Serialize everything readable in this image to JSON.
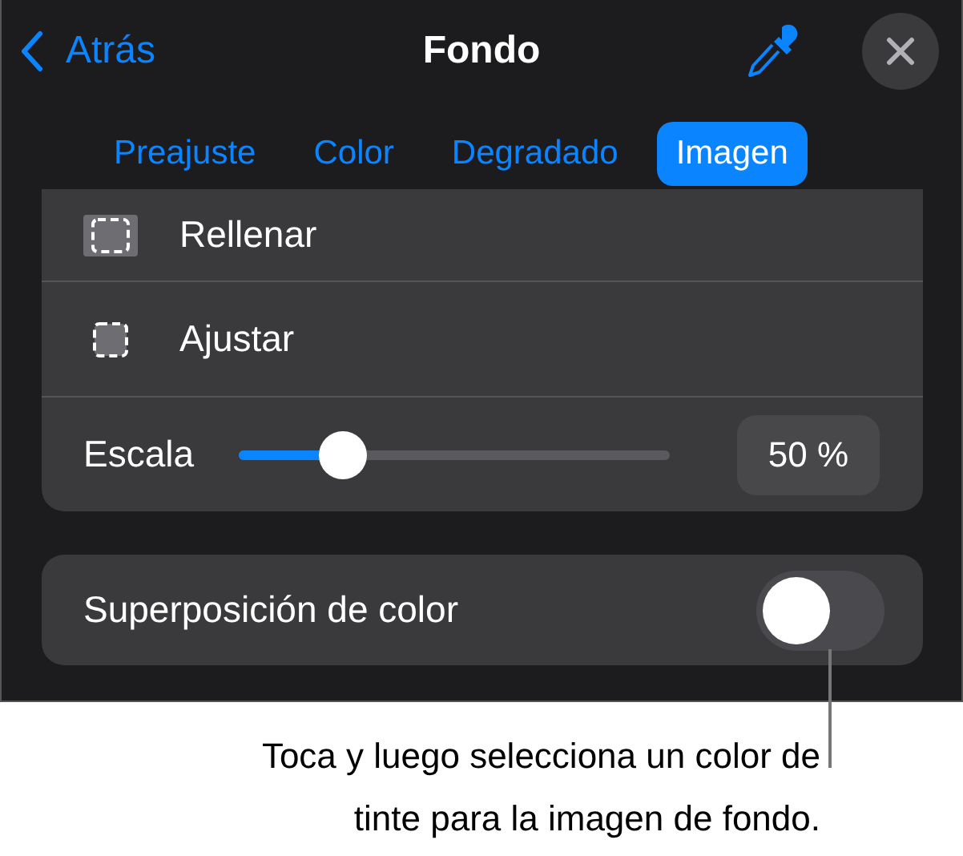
{
  "header": {
    "back": "Atrás",
    "title": "Fondo"
  },
  "tabs": [
    {
      "label": "Preajuste",
      "selected": false
    },
    {
      "label": "Color",
      "selected": false
    },
    {
      "label": "Degradado",
      "selected": false
    },
    {
      "label": "Imagen",
      "selected": true
    }
  ],
  "options": [
    {
      "kind": "fill",
      "label": "Rellenar"
    },
    {
      "kind": "fit",
      "label": "Ajustar"
    }
  ],
  "scale": {
    "label": "Escala",
    "level": 0.24,
    "reading": "50 %"
  },
  "overlay": {
    "label": "Superposición de color",
    "on": false
  },
  "callout": "Toca y luego selecciona un color de tinte para la imagen de fondo."
}
